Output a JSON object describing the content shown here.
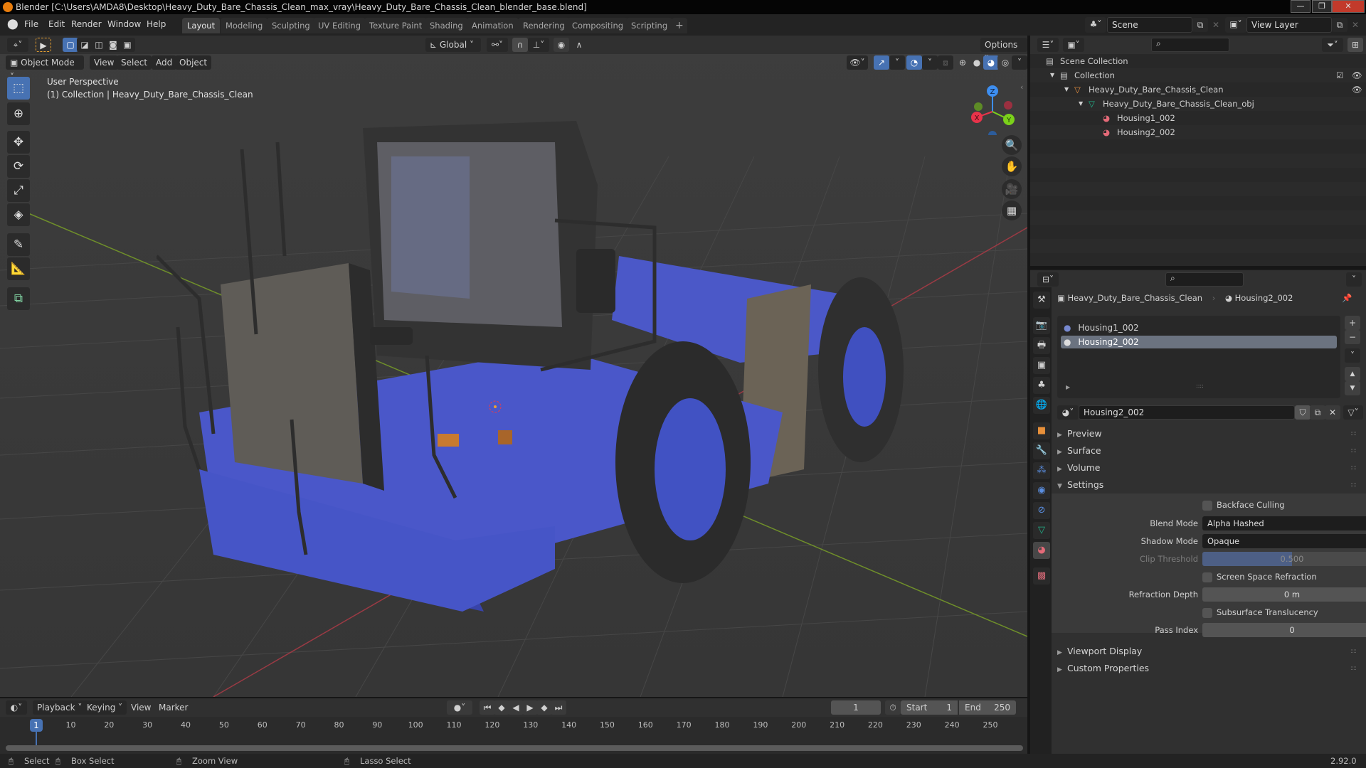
{
  "window": {
    "title": "Blender [C:\\Users\\AMDA8\\Desktop\\Heavy_Duty_Bare_Chassis_Clean_max_vray\\Heavy_Duty_Bare_Chassis_Clean_blender_base.blend]",
    "minimize": "—",
    "maximize": "❐",
    "close": "✕"
  },
  "menu": [
    "File",
    "Edit",
    "Render",
    "Window",
    "Help"
  ],
  "workspaces": [
    {
      "label": "Layout",
      "active": true
    },
    {
      "label": "Modeling"
    },
    {
      "label": "Sculpting"
    },
    {
      "label": "UV Editing"
    },
    {
      "label": "Texture Paint"
    },
    {
      "label": "Shading"
    },
    {
      "label": "Animation"
    },
    {
      "label": "Rendering"
    },
    {
      "label": "Compositing"
    },
    {
      "label": "Scripting"
    }
  ],
  "add_workspace": "+",
  "scene": {
    "name": "Scene",
    "view_layer": "View Layer"
  },
  "toolbar": {
    "orientation": "Global",
    "options": "Options"
  },
  "viewport_header": {
    "mode": "Object Mode",
    "menus": [
      "View",
      "Select",
      "Add",
      "Object"
    ]
  },
  "viewport_overlay": {
    "line1": "User Perspective",
    "line2": "(1) Collection | Heavy_Duty_Bare_Chassis_Clean"
  },
  "gizmo": {
    "x": "X",
    "y": "Y",
    "z": "Z"
  },
  "tools": [
    "select-box",
    "cursor",
    "move",
    "rotate",
    "scale",
    "transform",
    "annotate",
    "measure",
    "add-cube"
  ],
  "outliner": {
    "rows": [
      {
        "label": "Scene Collection",
        "icon": "scene-collection-icon",
        "depth": 0
      },
      {
        "label": "Collection",
        "icon": "collection-icon",
        "depth": 1,
        "checked": true,
        "visible": true
      },
      {
        "label": "Heavy_Duty_Bare_Chassis_Clean",
        "icon": "object-icon",
        "depth": 2,
        "visible": true
      },
      {
        "label": "Heavy_Duty_Bare_Chassis_Clean_obj",
        "icon": "mesh-data-icon",
        "depth": 3
      },
      {
        "label": "Housing1_002",
        "icon": "material-icon",
        "depth": 4
      },
      {
        "label": "Housing2_002",
        "icon": "material-icon",
        "depth": 4
      }
    ]
  },
  "properties": {
    "breadcrumb": {
      "object": "Heavy_Duty_Bare_Chassis_Clean",
      "material": "Housing2_002"
    },
    "material_slots": [
      {
        "label": "Housing1_002",
        "selected": false
      },
      {
        "label": "Housing2_002",
        "selected": true
      }
    ],
    "material_name": "Housing2_002",
    "panels": {
      "preview": "Preview",
      "surface": "Surface",
      "volume": "Volume",
      "settings": "Settings",
      "viewport_display": "Viewport Display",
      "custom_properties": "Custom Properties"
    },
    "settings": {
      "backface_culling": {
        "label": "Backface Culling",
        "checked": false
      },
      "blend_mode": {
        "label": "Blend Mode",
        "value": "Alpha Hashed"
      },
      "shadow_mode": {
        "label": "Shadow Mode",
        "value": "Opaque"
      },
      "clip_threshold": {
        "label": "Clip Threshold",
        "value": "0.500",
        "fraction": 0.5
      },
      "screen_space_refraction": {
        "label": "Screen Space Refraction",
        "checked": false
      },
      "refraction_depth": {
        "label": "Refraction Depth",
        "value": "0 m"
      },
      "subsurface_translucency": {
        "label": "Subsurface Translucency",
        "checked": false
      },
      "pass_index": {
        "label": "Pass Index",
        "value": "0"
      }
    }
  },
  "timeline": {
    "menus": [
      "Playback",
      "Keying",
      "View",
      "Marker"
    ],
    "current_frame": "1",
    "start_label": "Start",
    "start": "1",
    "end_label": "End",
    "end": "250",
    "ticks": [
      "10",
      "20",
      "30",
      "40",
      "50",
      "60",
      "70",
      "80",
      "90",
      "100",
      "110",
      "120",
      "130",
      "140",
      "150",
      "160",
      "170",
      "180",
      "190",
      "200",
      "210",
      "220",
      "230",
      "240",
      "250"
    ],
    "playhead": "1"
  },
  "statusbar": {
    "select": "Select",
    "box_select": "Box Select",
    "zoom_view": "Zoom View",
    "lasso_select": "Lasso Select",
    "version": "2.92.0"
  },
  "colors": {
    "accent": "#4772b3",
    "truck_blue": "#4a57c9",
    "axis_x": "#e8334a",
    "axis_y": "#7bd11a",
    "axis_z": "#3d8ef0"
  }
}
